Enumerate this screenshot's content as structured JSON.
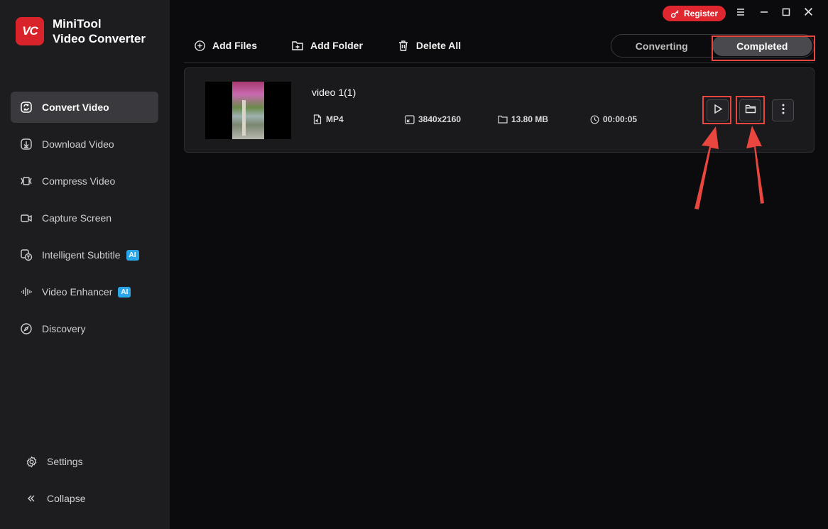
{
  "app": {
    "logo_text": "VC",
    "name_line1": "MiniTool",
    "name_line2": "Video Converter"
  },
  "sidebar": {
    "items": [
      {
        "label": "Convert Video",
        "icon": "convert-icon",
        "active": true
      },
      {
        "label": "Download Video",
        "icon": "download-icon"
      },
      {
        "label": "Compress Video",
        "icon": "compress-icon"
      },
      {
        "label": "Capture Screen",
        "icon": "camera-icon"
      },
      {
        "label": "Intelligent Subtitle",
        "icon": "subtitle-icon",
        "badge": "AI"
      },
      {
        "label": "Video Enhancer",
        "icon": "waveform-icon",
        "badge": "AI"
      },
      {
        "label": "Discovery",
        "icon": "compass-icon"
      }
    ],
    "settings_label": "Settings",
    "collapse_label": "Collapse"
  },
  "window": {
    "register_label": "Register"
  },
  "toolbar": {
    "add_files": "Add Files",
    "add_folder": "Add Folder",
    "delete_all": "Delete All"
  },
  "tabs": {
    "converting": "Converting",
    "completed": "Completed",
    "active": "completed"
  },
  "file": {
    "title": "video 1(1)",
    "format": "MP4",
    "resolution": "3840x2160",
    "size": "13.80 MB",
    "duration": "00:00:05"
  },
  "colors": {
    "accent_red": "#e0272f",
    "highlight": "#e8463f",
    "ai_badge": "#2aa6e8"
  }
}
